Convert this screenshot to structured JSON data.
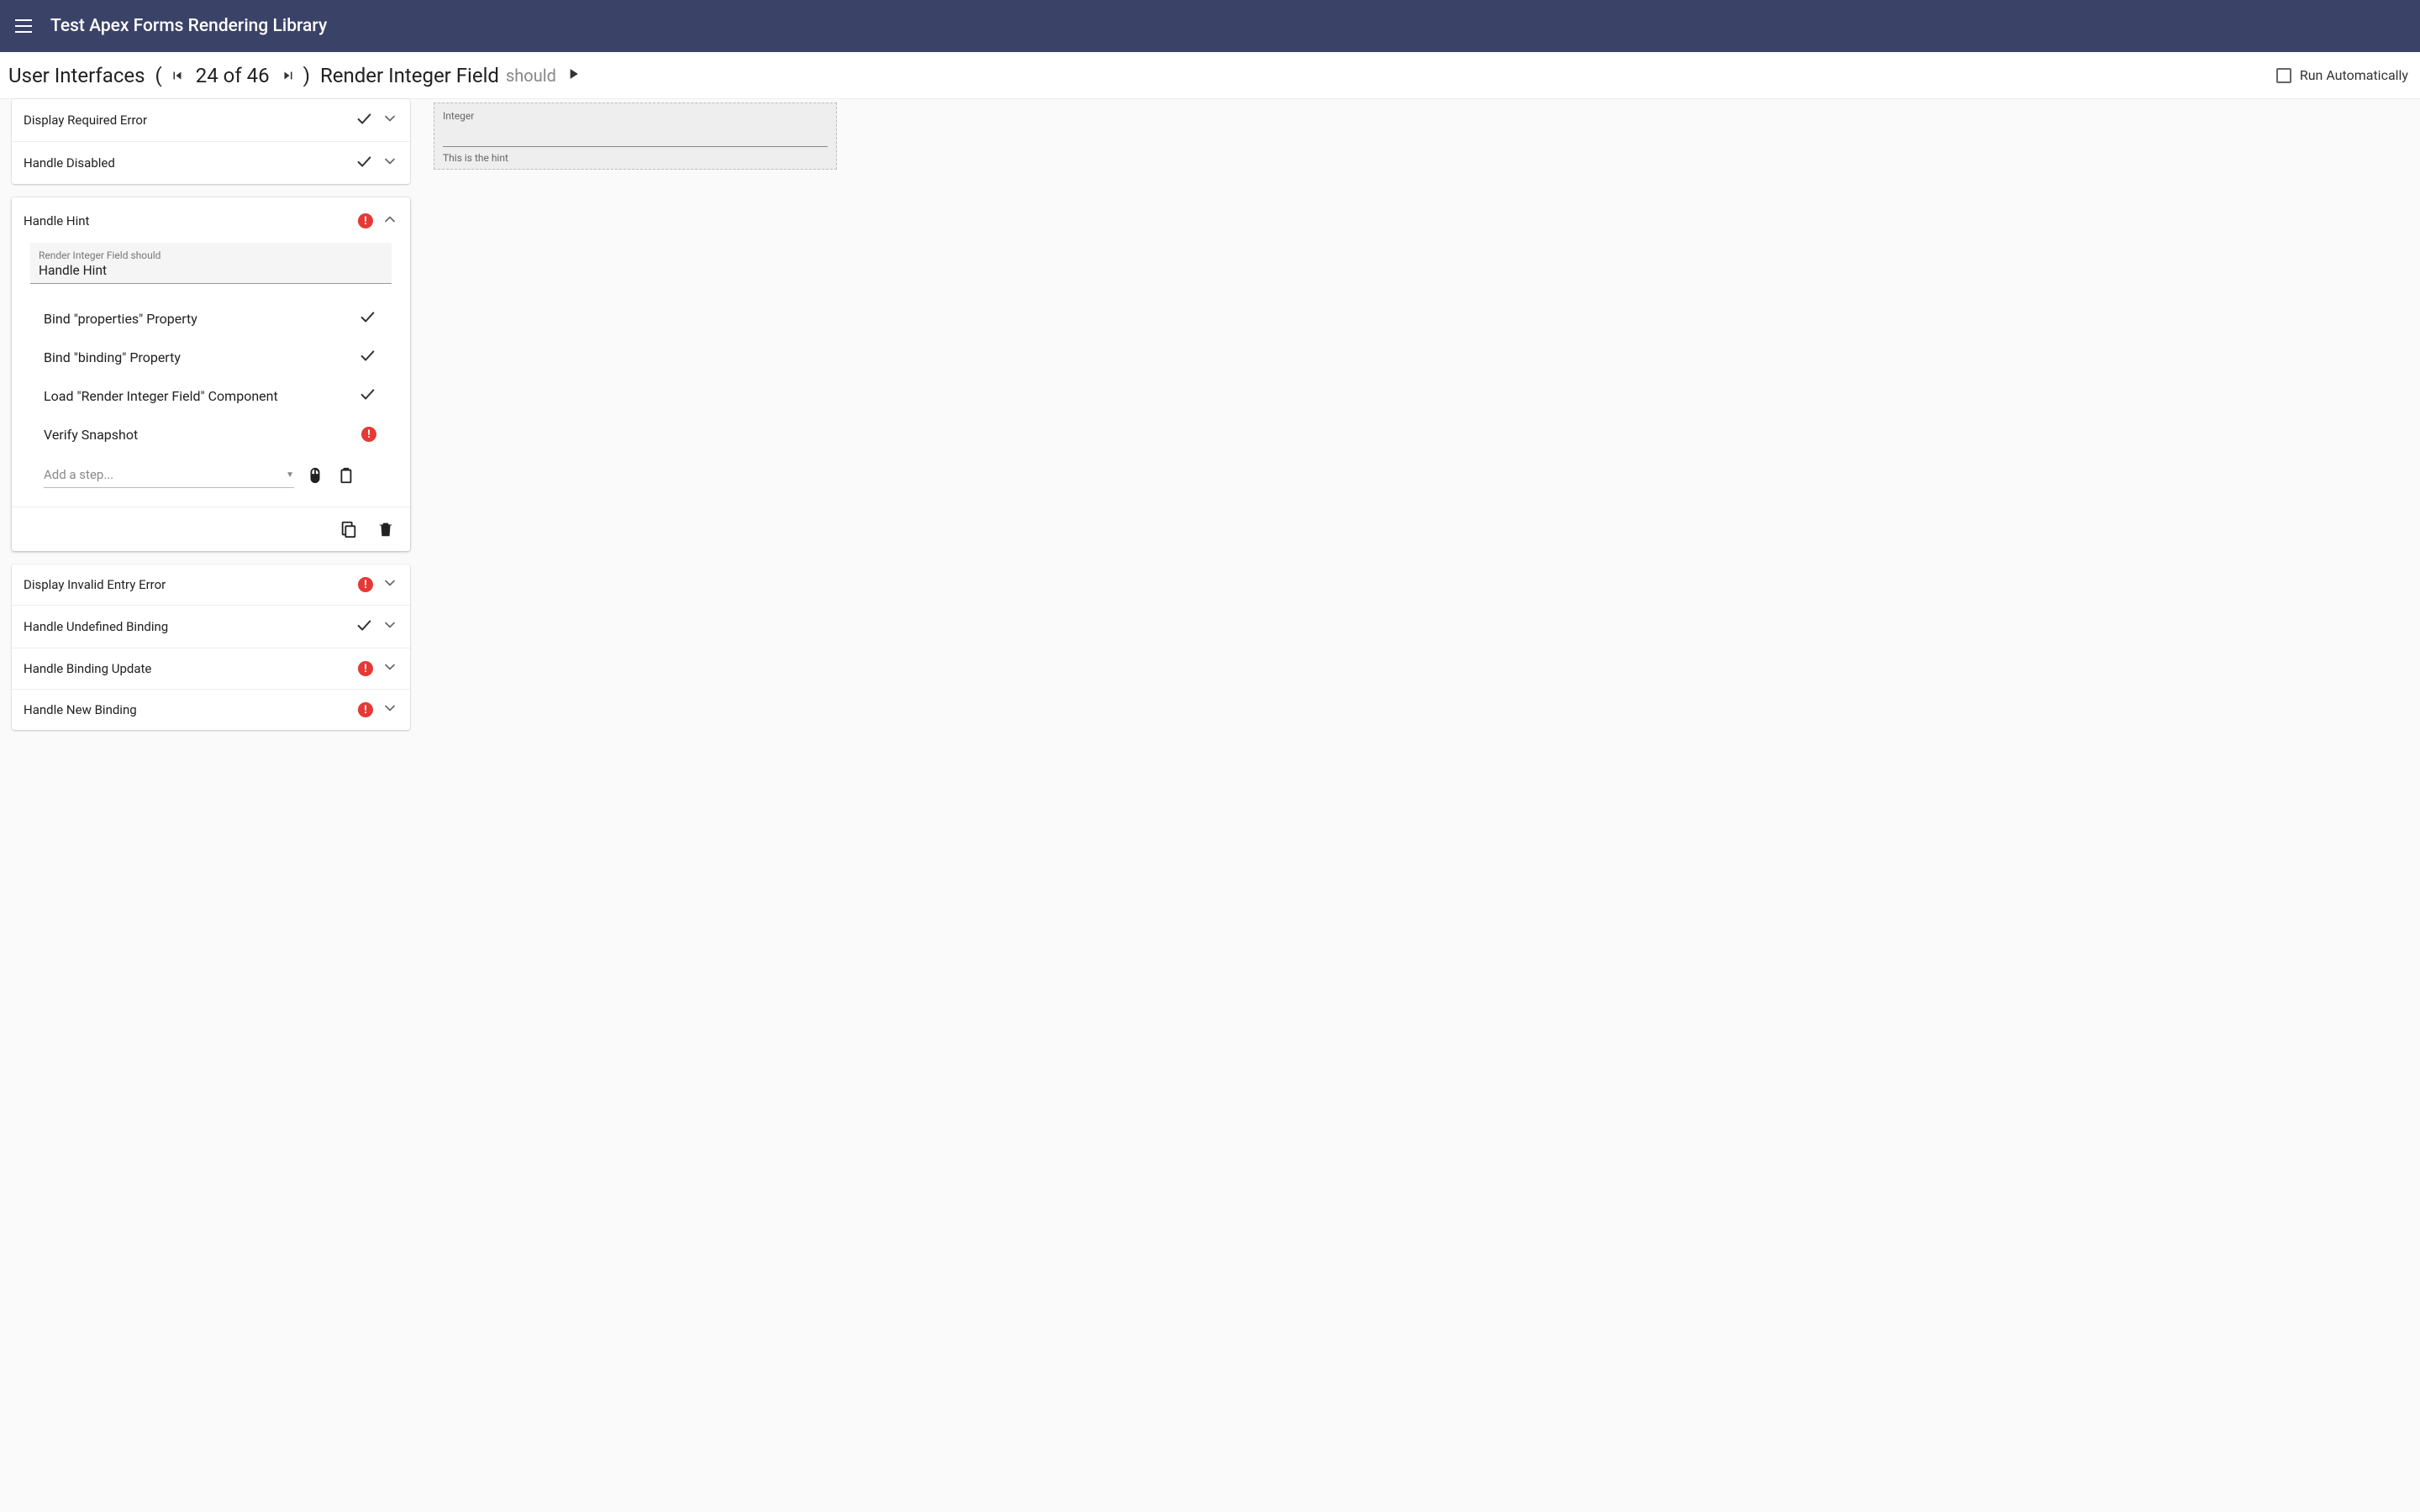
{
  "app": {
    "title": "Test Apex Forms Rendering Library"
  },
  "subheader": {
    "category": "User Interfaces",
    "counter": "24 of 46",
    "title": "Render Integer Field",
    "should": "should",
    "run_auto": "Run Automatically"
  },
  "top_tests": [
    {
      "label": "Display Required Error",
      "status": "check"
    },
    {
      "label": "Handle Disabled",
      "status": "check"
    }
  ],
  "expanded": {
    "label": "Handle Hint",
    "status": "error",
    "context_small": "Render Integer Field should",
    "context_big": "Handle Hint",
    "steps": [
      {
        "label": "Bind \"properties\" Property",
        "status": "check"
      },
      {
        "label": "Bind \"binding\" Property",
        "status": "check"
      },
      {
        "label": "Load \"Render Integer Field\" Component",
        "status": "check"
      },
      {
        "label": "Verify Snapshot",
        "status": "error"
      }
    ],
    "add_step_placeholder": "Add a step..."
  },
  "bottom_tests": [
    {
      "label": "Display Invalid Entry Error",
      "status": "error"
    },
    {
      "label": "Handle Undefined Binding",
      "status": "check"
    },
    {
      "label": "Handle Binding Update",
      "status": "error"
    },
    {
      "label": "Handle New Binding",
      "status": "error"
    }
  ],
  "preview": {
    "label": "Integer",
    "hint": "This is the hint"
  }
}
